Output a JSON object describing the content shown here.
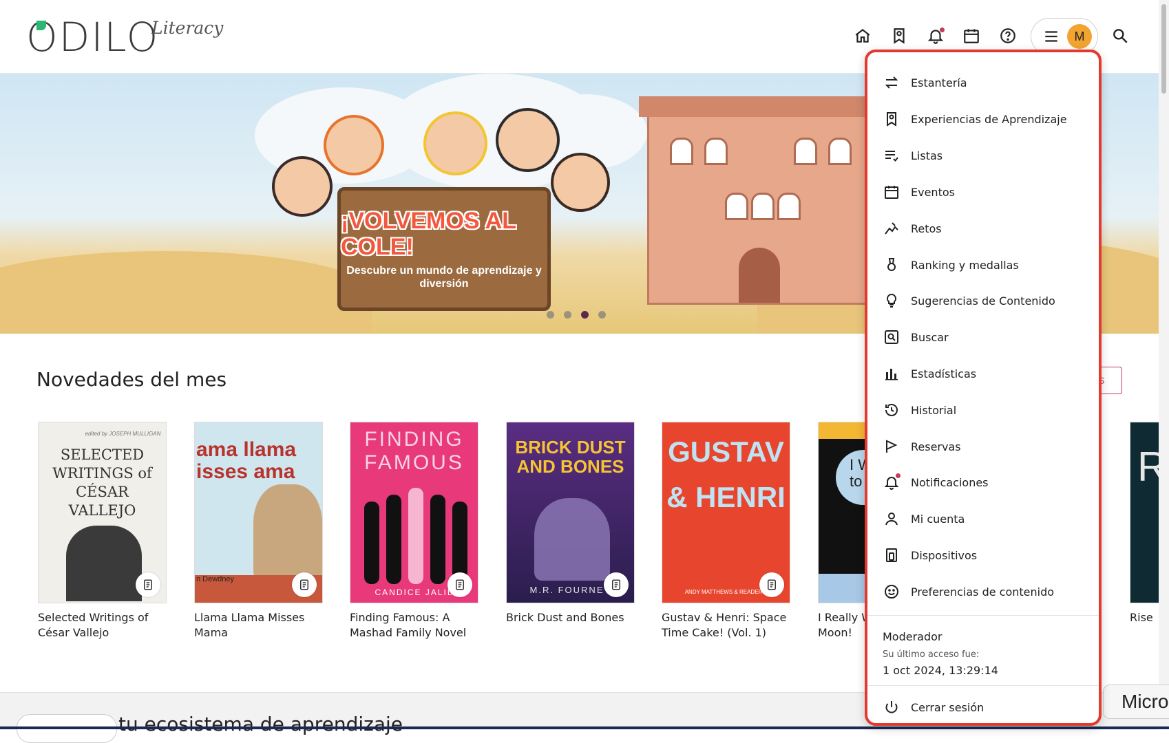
{
  "app": {
    "logo": "ODILO",
    "logo_sub": "Literacy"
  },
  "header": {
    "icons": [
      "home-icon",
      "learning-experience-icon",
      "bell-icon",
      "calendar-icon",
      "help-icon"
    ],
    "avatar_initial": "M"
  },
  "banner": {
    "headline": "¡VOLVEMOS AL COLE!",
    "subline": "Descubre un mundo de aprendizaje y diversión",
    "slides": 4,
    "active_slide": 3
  },
  "section": {
    "title": "Novedades del mes",
    "see_all": "AS"
  },
  "books": [
    {
      "title": "Selected Writings of César Vallejo",
      "cover_text": "SELECTED WRITINGS of CÉSAR VALLEJO",
      "cover_top": "edited by JOSEPH MULLIGAN"
    },
    {
      "title": "Llama Llama Misses Mama",
      "cover_text": "ama llama isses ama",
      "cover_bottom": "n Dewdney"
    },
    {
      "title": "Finding Famous: A Mashad Family Novel",
      "cover_text": "FINDING FAMOUS",
      "cover_bottom": "CANDICE JALIL"
    },
    {
      "title": "Brick Dust and Bones",
      "cover_text": "BRICK DUST AND BONES",
      "cover_bottom": "M.R. FOURNET"
    },
    {
      "title": "Gustav & Henri: Space Time Cake! (Vol. 1)",
      "cover_text": "GUSTAV & HENRI",
      "cover_bottom": "ANDY MATTHEWS & READER T"
    },
    {
      "title": "I Really W... Moon!",
      "line1": "I Really W",
      "line2": "Moon!",
      "cover_text": "I Wa to"
    },
    {
      "title": "Rise",
      "cover_text": "R"
    }
  ],
  "menu": {
    "items": [
      {
        "label": "Estantería",
        "icon": "swap-arrows-icon"
      },
      {
        "label": "Experiencias de Aprendizaje",
        "icon": "learning-experience-icon"
      },
      {
        "label": "Listas",
        "icon": "list-heart-icon"
      },
      {
        "label": "Eventos",
        "icon": "calendar-icon"
      },
      {
        "label": "Retos",
        "icon": "challenge-icon"
      },
      {
        "label": "Ranking y medallas",
        "icon": "medal-icon"
      },
      {
        "label": "Sugerencias de Contenido",
        "icon": "lightbulb-icon"
      },
      {
        "label": "Buscar",
        "icon": "search-box-icon"
      },
      {
        "label": "Estadísticas",
        "icon": "bar-chart-icon"
      },
      {
        "label": "Historial",
        "icon": "history-icon"
      },
      {
        "label": "Reservas",
        "icon": "flag-icon"
      },
      {
        "label": "Notificaciones",
        "icon": "bell-icon"
      },
      {
        "label": "Mi cuenta",
        "icon": "user-icon"
      },
      {
        "label": "Dispositivos",
        "icon": "devices-icon"
      },
      {
        "label": "Preferencias de contenido",
        "icon": "smiley-icon"
      }
    ],
    "role": "Moderador",
    "last_access_label": "Su último acceso fue:",
    "last_access_date": "1 oct 2024, 13:29:14",
    "logout": "Cerrar sesión",
    "accent_color": "#e4392f"
  },
  "footer": {
    "heading_partial": "tu ecosistema de aprendizaje",
    "micro_pill": "Micro"
  }
}
